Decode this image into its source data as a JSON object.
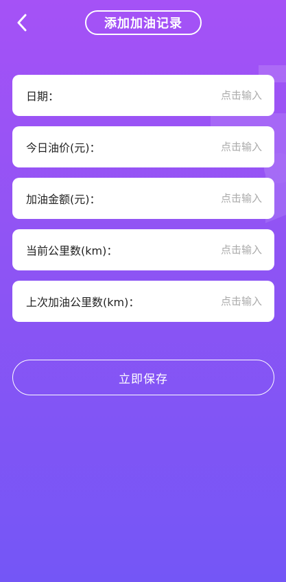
{
  "header": {
    "back_icon": "chevron-left-icon",
    "title": "添加加油记录"
  },
  "form": {
    "fields": [
      {
        "label": "日期：",
        "placeholder": "点击输入",
        "value": ""
      },
      {
        "label": "今日油价(元)：",
        "placeholder": "点击输入",
        "value": ""
      },
      {
        "label": "加油金额(元)：",
        "placeholder": "点击输入",
        "value": ""
      },
      {
        "label": "当前公里数(km)：",
        "placeholder": "点击输入",
        "value": ""
      },
      {
        "label": "上次加油公里数(km)：",
        "placeholder": "点击输入",
        "value": ""
      }
    ]
  },
  "actions": {
    "save_label": "立即保存"
  },
  "colors": {
    "gradient_top": "#a552f6",
    "gradient_bottom": "#7456f6",
    "card": "#ffffff",
    "placeholder": "#aaaaaa"
  }
}
